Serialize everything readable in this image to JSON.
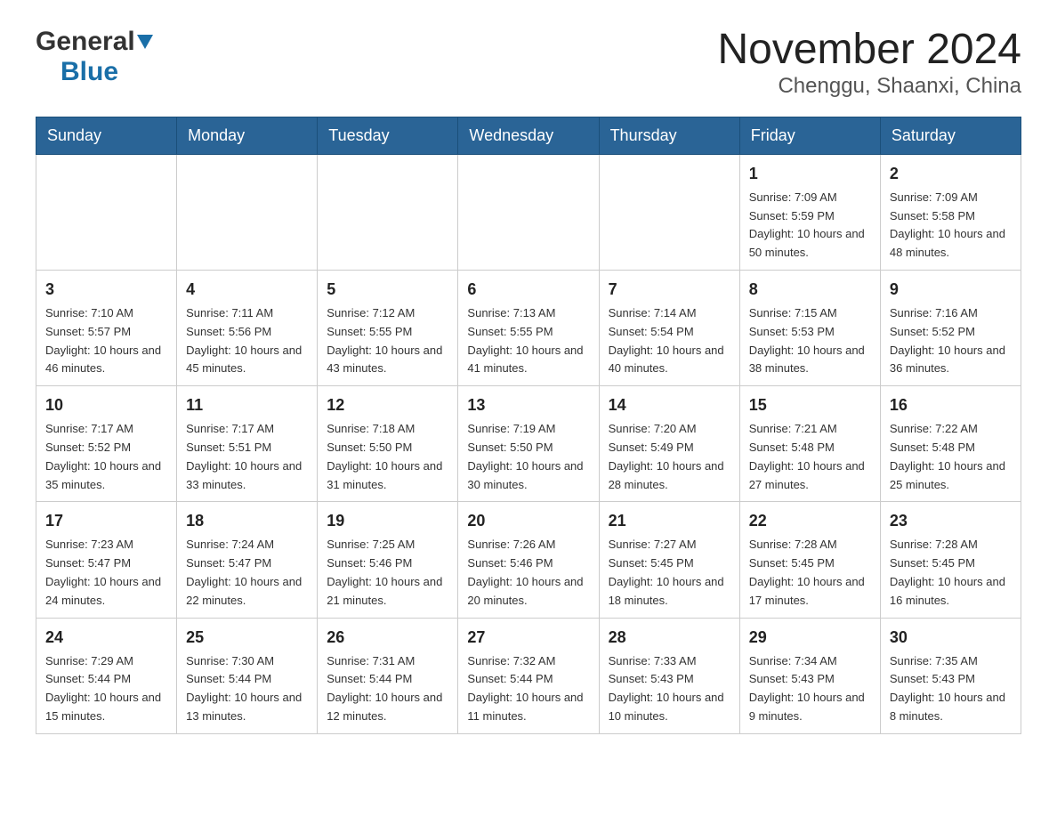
{
  "header": {
    "logo_general": "General",
    "logo_blue": "Blue",
    "title": "November 2024",
    "subtitle": "Chenggu, Shaanxi, China"
  },
  "weekdays": [
    "Sunday",
    "Monday",
    "Tuesday",
    "Wednesday",
    "Thursday",
    "Friday",
    "Saturday"
  ],
  "weeks": [
    [
      {
        "day": "",
        "info": ""
      },
      {
        "day": "",
        "info": ""
      },
      {
        "day": "",
        "info": ""
      },
      {
        "day": "",
        "info": ""
      },
      {
        "day": "",
        "info": ""
      },
      {
        "day": "1",
        "info": "Sunrise: 7:09 AM\nSunset: 5:59 PM\nDaylight: 10 hours and 50 minutes."
      },
      {
        "day": "2",
        "info": "Sunrise: 7:09 AM\nSunset: 5:58 PM\nDaylight: 10 hours and 48 minutes."
      }
    ],
    [
      {
        "day": "3",
        "info": "Sunrise: 7:10 AM\nSunset: 5:57 PM\nDaylight: 10 hours and 46 minutes."
      },
      {
        "day": "4",
        "info": "Sunrise: 7:11 AM\nSunset: 5:56 PM\nDaylight: 10 hours and 45 minutes."
      },
      {
        "day": "5",
        "info": "Sunrise: 7:12 AM\nSunset: 5:55 PM\nDaylight: 10 hours and 43 minutes."
      },
      {
        "day": "6",
        "info": "Sunrise: 7:13 AM\nSunset: 5:55 PM\nDaylight: 10 hours and 41 minutes."
      },
      {
        "day": "7",
        "info": "Sunrise: 7:14 AM\nSunset: 5:54 PM\nDaylight: 10 hours and 40 minutes."
      },
      {
        "day": "8",
        "info": "Sunrise: 7:15 AM\nSunset: 5:53 PM\nDaylight: 10 hours and 38 minutes."
      },
      {
        "day": "9",
        "info": "Sunrise: 7:16 AM\nSunset: 5:52 PM\nDaylight: 10 hours and 36 minutes."
      }
    ],
    [
      {
        "day": "10",
        "info": "Sunrise: 7:17 AM\nSunset: 5:52 PM\nDaylight: 10 hours and 35 minutes."
      },
      {
        "day": "11",
        "info": "Sunrise: 7:17 AM\nSunset: 5:51 PM\nDaylight: 10 hours and 33 minutes."
      },
      {
        "day": "12",
        "info": "Sunrise: 7:18 AM\nSunset: 5:50 PM\nDaylight: 10 hours and 31 minutes."
      },
      {
        "day": "13",
        "info": "Sunrise: 7:19 AM\nSunset: 5:50 PM\nDaylight: 10 hours and 30 minutes."
      },
      {
        "day": "14",
        "info": "Sunrise: 7:20 AM\nSunset: 5:49 PM\nDaylight: 10 hours and 28 minutes."
      },
      {
        "day": "15",
        "info": "Sunrise: 7:21 AM\nSunset: 5:48 PM\nDaylight: 10 hours and 27 minutes."
      },
      {
        "day": "16",
        "info": "Sunrise: 7:22 AM\nSunset: 5:48 PM\nDaylight: 10 hours and 25 minutes."
      }
    ],
    [
      {
        "day": "17",
        "info": "Sunrise: 7:23 AM\nSunset: 5:47 PM\nDaylight: 10 hours and 24 minutes."
      },
      {
        "day": "18",
        "info": "Sunrise: 7:24 AM\nSunset: 5:47 PM\nDaylight: 10 hours and 22 minutes."
      },
      {
        "day": "19",
        "info": "Sunrise: 7:25 AM\nSunset: 5:46 PM\nDaylight: 10 hours and 21 minutes."
      },
      {
        "day": "20",
        "info": "Sunrise: 7:26 AM\nSunset: 5:46 PM\nDaylight: 10 hours and 20 minutes."
      },
      {
        "day": "21",
        "info": "Sunrise: 7:27 AM\nSunset: 5:45 PM\nDaylight: 10 hours and 18 minutes."
      },
      {
        "day": "22",
        "info": "Sunrise: 7:28 AM\nSunset: 5:45 PM\nDaylight: 10 hours and 17 minutes."
      },
      {
        "day": "23",
        "info": "Sunrise: 7:28 AM\nSunset: 5:45 PM\nDaylight: 10 hours and 16 minutes."
      }
    ],
    [
      {
        "day": "24",
        "info": "Sunrise: 7:29 AM\nSunset: 5:44 PM\nDaylight: 10 hours and 15 minutes."
      },
      {
        "day": "25",
        "info": "Sunrise: 7:30 AM\nSunset: 5:44 PM\nDaylight: 10 hours and 13 minutes."
      },
      {
        "day": "26",
        "info": "Sunrise: 7:31 AM\nSunset: 5:44 PM\nDaylight: 10 hours and 12 minutes."
      },
      {
        "day": "27",
        "info": "Sunrise: 7:32 AM\nSunset: 5:44 PM\nDaylight: 10 hours and 11 minutes."
      },
      {
        "day": "28",
        "info": "Sunrise: 7:33 AM\nSunset: 5:43 PM\nDaylight: 10 hours and 10 minutes."
      },
      {
        "day": "29",
        "info": "Sunrise: 7:34 AM\nSunset: 5:43 PM\nDaylight: 10 hours and 9 minutes."
      },
      {
        "day": "30",
        "info": "Sunrise: 7:35 AM\nSunset: 5:43 PM\nDaylight: 10 hours and 8 minutes."
      }
    ]
  ]
}
